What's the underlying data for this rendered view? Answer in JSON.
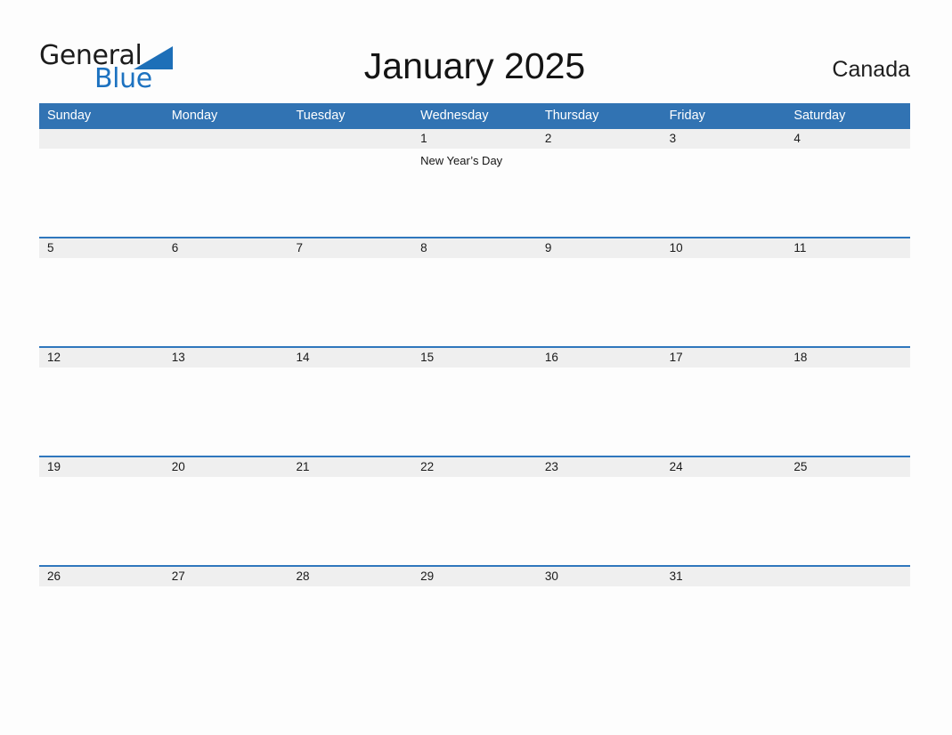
{
  "brand": {
    "word_one": "General",
    "word_two": "Blue",
    "triangle_color": "#1d6fb8"
  },
  "header": {
    "title": "January 2025",
    "country": "Canada"
  },
  "colors": {
    "header_blue": "#3173b3",
    "rule_blue": "#2f77bd",
    "date_band_gray": "#efefef",
    "page_background": "#fdfdfd",
    "text": "#141414"
  },
  "calendar": {
    "month": "January",
    "year": "2025",
    "day_headers": [
      "Sunday",
      "Monday",
      "Tuesday",
      "Wednesday",
      "Thursday",
      "Friday",
      "Saturday"
    ],
    "weeks": [
      {
        "days": [
          {
            "date": "",
            "events": []
          },
          {
            "date": "",
            "events": []
          },
          {
            "date": "",
            "events": []
          },
          {
            "date": "1",
            "events": [
              "New Year’s Day"
            ]
          },
          {
            "date": "2",
            "events": []
          },
          {
            "date": "3",
            "events": []
          },
          {
            "date": "4",
            "events": []
          }
        ]
      },
      {
        "days": [
          {
            "date": "5",
            "events": []
          },
          {
            "date": "6",
            "events": []
          },
          {
            "date": "7",
            "events": []
          },
          {
            "date": "8",
            "events": []
          },
          {
            "date": "9",
            "events": []
          },
          {
            "date": "10",
            "events": []
          },
          {
            "date": "11",
            "events": []
          }
        ]
      },
      {
        "days": [
          {
            "date": "12",
            "events": []
          },
          {
            "date": "13",
            "events": []
          },
          {
            "date": "14",
            "events": []
          },
          {
            "date": "15",
            "events": []
          },
          {
            "date": "16",
            "events": []
          },
          {
            "date": "17",
            "events": []
          },
          {
            "date": "18",
            "events": []
          }
        ]
      },
      {
        "days": [
          {
            "date": "19",
            "events": []
          },
          {
            "date": "20",
            "events": []
          },
          {
            "date": "21",
            "events": []
          },
          {
            "date": "22",
            "events": []
          },
          {
            "date": "23",
            "events": []
          },
          {
            "date": "24",
            "events": []
          },
          {
            "date": "25",
            "events": []
          }
        ]
      },
      {
        "days": [
          {
            "date": "26",
            "events": []
          },
          {
            "date": "27",
            "events": []
          },
          {
            "date": "28",
            "events": []
          },
          {
            "date": "29",
            "events": []
          },
          {
            "date": "30",
            "events": []
          },
          {
            "date": "31",
            "events": []
          },
          {
            "date": "",
            "events": []
          }
        ]
      }
    ]
  }
}
